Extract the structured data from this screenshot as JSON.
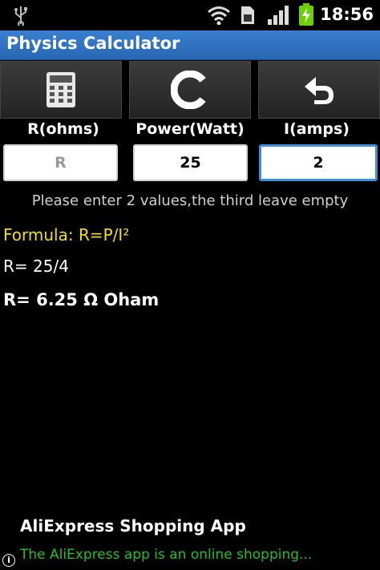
{
  "status_bar": {
    "time": "18:56",
    "icons": [
      "usb-icon",
      "wifi-icon",
      "sim-icon",
      "signal-icon",
      "battery-charging-icon"
    ]
  },
  "app": {
    "title": "Physics Calculator"
  },
  "toolbar": {
    "buttons": [
      {
        "name": "calculator",
        "icon": "calculator-icon"
      },
      {
        "name": "clear",
        "icon": "clear-c-icon"
      },
      {
        "name": "back",
        "icon": "undo-arrow-icon"
      }
    ]
  },
  "fields": {
    "r": {
      "label": "R(ohms)",
      "value": "",
      "placeholder": "R"
    },
    "p": {
      "label": "Power(Watt)",
      "value": "25",
      "placeholder": ""
    },
    "i": {
      "label": "I(amps)",
      "value": "2",
      "placeholder": ""
    }
  },
  "hint": "Please enter 2 values,the third leave empty",
  "output": {
    "formula": "Formula: R=P/I²",
    "calculation": "R= 25/4",
    "result": "R= 6.25  Ω Oham"
  },
  "colors": {
    "formula": "#f0e000",
    "title_bar": "#2f72c2",
    "ad_description": "#22c022",
    "focused_border": "#3f8fdf"
  },
  "ad": {
    "title": "AliExpress Shopping App",
    "description": "The AliExpress app is an online shopping...",
    "info_icon": "info-icon"
  }
}
